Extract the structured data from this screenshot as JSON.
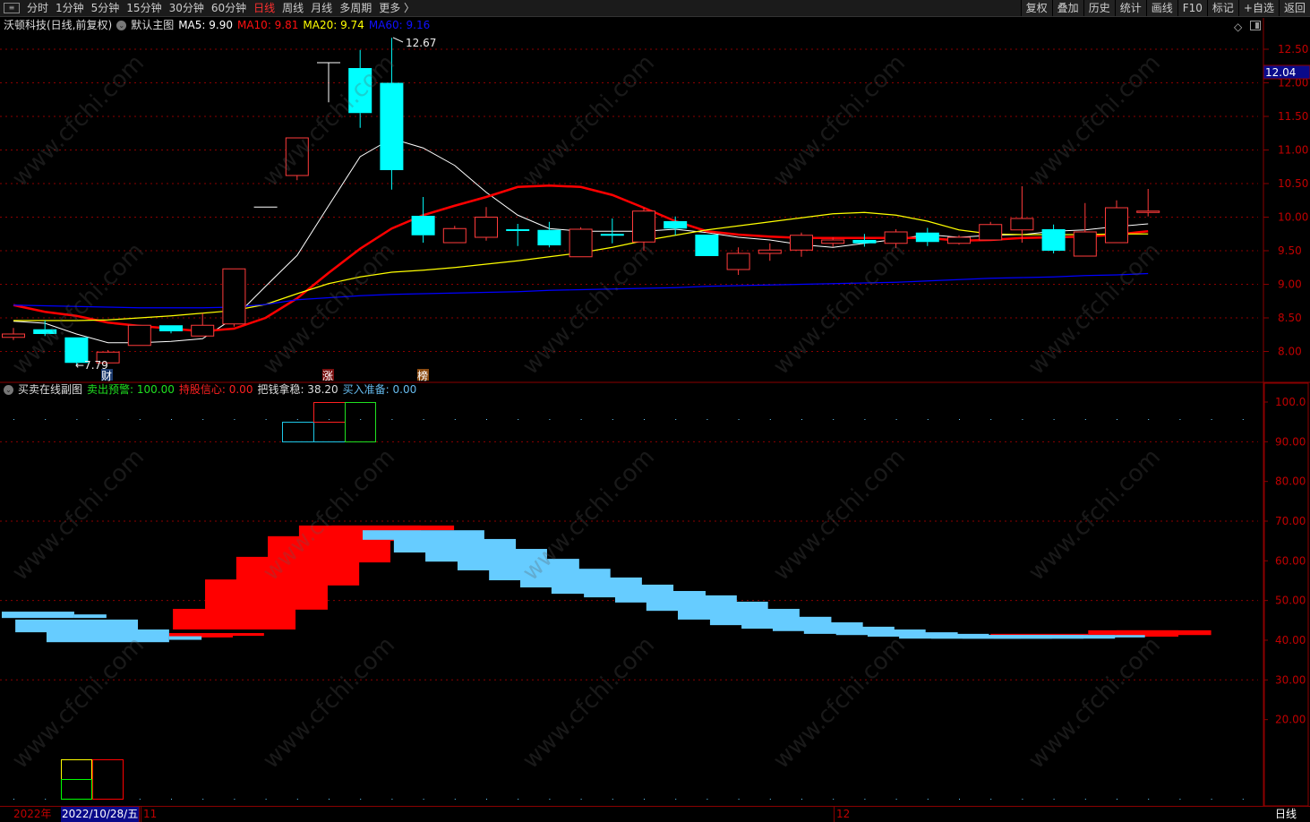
{
  "toolbar": {
    "periods": [
      "分时",
      "1分钟",
      "5分钟",
      "15分钟",
      "30分钟",
      "60分钟",
      "日线",
      "周线",
      "月线",
      "多周期",
      "更多 〉"
    ],
    "active_period": "日线",
    "actions": [
      "复权",
      "叠加",
      "历史",
      "统计",
      "画线",
      "F10",
      "标记",
      "+自选",
      "返回"
    ]
  },
  "main_legend": {
    "stock": "沃顿科技(日线,前复权)",
    "template": "默认主图",
    "ma5": "MA5: 9.90",
    "ma10": "MA10: 9.81",
    "ma20": "MA20: 9.74",
    "ma60": "MA60: 9.16"
  },
  "sub_legend": {
    "name": "买卖在线副图",
    "sell_warning": "卖出预警: 100.00",
    "hold_confidence": "持股信心: 0.00",
    "hold_steady": "把钱拿稳: 38.20",
    "buy_ready": "买入准备: 0.00"
  },
  "annotations": {
    "high_label": "12.67",
    "low_label": "←7.79",
    "marker_cai": "财",
    "marker_zhang": "涨",
    "marker_bang": "榜"
  },
  "cursor_price": "12.04",
  "date_axis": {
    "year": "2022年",
    "cursor_date": "2022/10/28/五",
    "month_11": "11",
    "month_12": "12",
    "period_label": "日线"
  },
  "watermark": "www.cfchi.com",
  "colors": {
    "up": "#ff3b3b",
    "down": "#00ffff",
    "ma5": "#ffffff",
    "ma10": "#ff0000",
    "ma20": "#ffff00",
    "ma60": "#0000ff",
    "grid": "#8b0000",
    "sub_blue": "#66ccff",
    "sub_red": "#ff0000"
  },
  "chart_data": [
    {
      "type": "candlestick",
      "title": "沃顿科技(日线,前复权)",
      "ylim": [
        7.6,
        12.8
      ],
      "yticks": [
        "12.50",
        "12.00",
        "11.50",
        "11.00",
        "10.50",
        "10.00",
        "9.50",
        "9.00",
        "8.50",
        "8.00"
      ],
      "grid": true,
      "ohlc": [
        [
          8.21,
          8.35,
          8.17,
          8.26
        ],
        [
          8.33,
          8.46,
          8.23,
          8.26
        ],
        [
          8.21,
          8.21,
          7.79,
          7.83
        ],
        [
          7.83,
          8.02,
          7.83,
          7.99
        ],
        [
          8.09,
          8.39,
          8.09,
          8.39
        ],
        [
          8.39,
          8.39,
          8.27,
          8.3
        ],
        [
          8.23,
          8.57,
          8.23,
          8.39
        ],
        [
          8.41,
          9.23,
          8.37,
          9.23
        ],
        [
          10.15,
          10.15,
          10.15,
          10.15
        ],
        [
          10.62,
          11.18,
          10.55,
          11.18
        ],
        [
          12.3,
          12.3,
          11.71,
          12.3
        ],
        [
          12.22,
          12.49,
          11.33,
          11.55
        ],
        [
          12.0,
          12.67,
          10.41,
          10.7
        ],
        [
          10.02,
          10.3,
          9.62,
          9.73
        ],
        [
          9.62,
          9.87,
          9.62,
          9.83
        ],
        [
          9.7,
          10.15,
          9.65,
          10.0
        ],
        [
          9.82,
          9.9,
          9.57,
          9.8
        ],
        [
          9.81,
          9.93,
          9.55,
          9.58
        ],
        [
          9.41,
          9.85,
          9.41,
          9.82
        ],
        [
          9.75,
          9.98,
          9.61,
          9.74
        ],
        [
          9.63,
          10.14,
          9.5,
          10.09
        ],
        [
          9.94,
          10.01,
          9.73,
          9.83
        ],
        [
          9.74,
          9.74,
          9.42,
          9.42
        ],
        [
          9.22,
          9.55,
          9.14,
          9.46
        ],
        [
          9.46,
          9.61,
          9.35,
          9.51
        ],
        [
          9.51,
          9.77,
          9.41,
          9.73
        ],
        [
          9.61,
          9.7,
          9.56,
          9.66
        ],
        [
          9.66,
          9.75,
          9.56,
          9.61
        ],
        [
          9.61,
          9.82,
          9.54,
          9.78
        ],
        [
          9.77,
          9.84,
          9.57,
          9.63
        ],
        [
          9.61,
          9.73,
          9.59,
          9.7
        ],
        [
          9.66,
          9.93,
          9.66,
          9.89
        ],
        [
          9.81,
          10.46,
          9.62,
          9.98
        ],
        [
          9.82,
          9.89,
          9.46,
          9.5
        ],
        [
          9.42,
          10.21,
          9.42,
          9.78
        ],
        [
          9.62,
          10.25,
          9.62,
          10.14
        ],
        [
          10.07,
          10.42,
          10.01,
          10.09
        ]
      ],
      "series": [
        {
          "name": "MA5",
          "values": [
            8.45,
            8.42,
            8.26,
            8.13,
            8.13,
            8.15,
            8.19,
            8.5,
            8.97,
            9.43,
            10.17,
            10.9,
            11.17,
            11.03,
            10.77,
            10.37,
            10.03,
            9.83,
            9.79,
            9.79,
            9.79,
            9.82,
            9.77,
            9.7,
            9.66,
            9.59,
            9.55,
            9.61,
            9.67,
            9.74,
            9.7,
            9.73,
            9.74,
            9.79,
            9.81,
            9.86,
            9.9
          ]
        },
        {
          "name": "MA10",
          "values": [
            8.69,
            8.59,
            8.53,
            8.43,
            8.38,
            8.34,
            8.3,
            8.34,
            8.5,
            8.79,
            9.17,
            9.53,
            9.83,
            10.03,
            10.17,
            10.3,
            10.45,
            10.47,
            10.45,
            10.33,
            10.14,
            9.94,
            9.79,
            9.74,
            9.71,
            9.69,
            9.69,
            9.69,
            9.69,
            9.69,
            9.65,
            9.66,
            9.69,
            9.7,
            9.71,
            9.74,
            9.79
          ]
        },
        {
          "name": "MA20",
          "values": [
            8.46,
            8.46,
            8.46,
            8.47,
            8.5,
            8.53,
            8.57,
            8.61,
            8.7,
            8.86,
            9.01,
            9.11,
            9.18,
            9.21,
            9.25,
            9.3,
            9.35,
            9.41,
            9.47,
            9.55,
            9.65,
            9.73,
            9.81,
            9.87,
            9.93,
            9.99,
            10.05,
            10.07,
            10.03,
            9.94,
            9.81,
            9.75,
            9.74,
            9.74,
            9.74,
            9.75,
            9.75
          ]
        },
        {
          "name": "MA60",
          "values": [
            8.69,
            8.68,
            8.67,
            8.66,
            8.65,
            8.65,
            8.65,
            8.66,
            8.7,
            8.77,
            8.8,
            8.83,
            8.85,
            8.86,
            8.87,
            8.88,
            8.89,
            8.91,
            8.92,
            8.93,
            8.94,
            8.95,
            8.97,
            8.98,
            8.99,
            9.0,
            9.01,
            9.02,
            9.03,
            9.05,
            9.07,
            9.09,
            9.1,
            9.11,
            9.13,
            9.14,
            9.16
          ]
        }
      ]
    },
    {
      "type": "bar",
      "title": "买卖在线副图",
      "ylim": [
        0,
        103
      ],
      "yticks": [
        "100.0",
        "90.00",
        "80.00",
        "70.00",
        "60.00",
        "50.00",
        "40.00",
        "30.00",
        "20.00"
      ],
      "grid": true,
      "bands_red": [
        [
          4.94,
          6.96,
          41.8,
          40.7
        ],
        [
          6.96,
          7.95,
          41.8,
          41.1
        ],
        [
          5.06,
          8.95,
          47.9,
          42.7
        ],
        [
          6.08,
          9.97,
          55.3,
          47.7
        ],
        [
          7.07,
          10.97,
          61.0,
          53.8
        ],
        [
          8.07,
          11.96,
          66.2,
          59.6
        ],
        [
          9.06,
          12.93,
          68.9,
          65.0
        ],
        [
          10.09,
          13.98,
          68.9,
          67.7
        ],
        [
          31.0,
          34.1,
          41.6,
          41.1
        ],
        [
          34.1,
          38.0,
          42.5,
          41.3
        ],
        [
          35.0,
          36.96,
          42.5,
          40.9
        ]
      ],
      "bands_blue": [
        [
          -0.37,
          1.93,
          47.2,
          45.6
        ],
        [
          1.93,
          2.95,
          46.5,
          45.6
        ],
        [
          0.06,
          3.95,
          45.2,
          42.0
        ],
        [
          1.05,
          4.94,
          42.7,
          39.5
        ],
        [
          4.94,
          5.97,
          41.0,
          40.1
        ],
        [
          11.08,
          14.94,
          67.7,
          65.3
        ],
        [
          12.07,
          15.94,
          65.5,
          62.1
        ],
        [
          13.07,
          16.93,
          63.0,
          59.8
        ],
        [
          14.09,
          17.95,
          60.5,
          57.6
        ],
        [
          15.09,
          18.94,
          58.0,
          55.1
        ],
        [
          16.08,
          19.94,
          55.8,
          53.3
        ],
        [
          17.07,
          20.94,
          54.0,
          51.7
        ],
        [
          18.1,
          21.96,
          52.4,
          50.8
        ],
        [
          19.09,
          22.95,
          51.3,
          49.5
        ],
        [
          20.08,
          23.94,
          49.7,
          47.4
        ],
        [
          21.08,
          24.94,
          47.9,
          45.2
        ],
        [
          22.1,
          25.95,
          45.9,
          43.8
        ],
        [
          23.1,
          26.95,
          44.5,
          42.9
        ],
        [
          24.09,
          27.95,
          43.4,
          42.3
        ],
        [
          25.08,
          28.94,
          42.7,
          41.6
        ],
        [
          26.1,
          29.96,
          42.0,
          41.3
        ],
        [
          27.1,
          30.95,
          41.6,
          40.9
        ],
        [
          28.1,
          31.95,
          41.3,
          40.4
        ],
        [
          29.12,
          32.95,
          41.3,
          40.4
        ],
        [
          30.11,
          33.95,
          41.3,
          40.4
        ],
        [
          31.1,
          34.95,
          41.3,
          40.4
        ],
        [
          32.13,
          35.9,
          41.3,
          40.7
        ]
      ]
    }
  ]
}
